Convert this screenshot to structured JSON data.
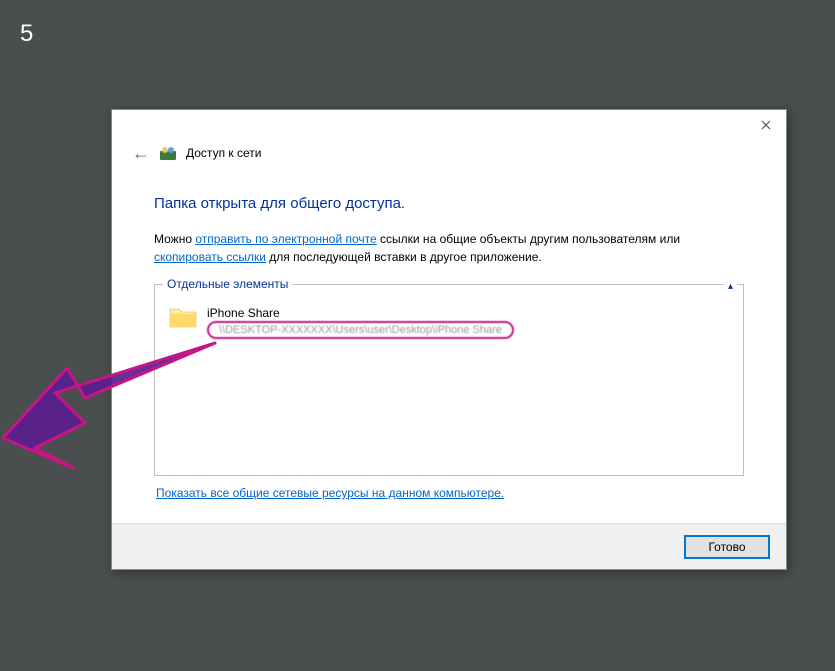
{
  "step_number": "5",
  "header": {
    "title": "Доступ к сети"
  },
  "main": {
    "heading": "Папка открыта для общего доступа.",
    "desc_part1": "Можно ",
    "link_email": "отправить по электронной почте",
    "desc_part2": " ссылки на общие объекты другим пользователям или ",
    "link_copy": "скопировать ссылки",
    "desc_part3": " для последующей вставки в другое приложение."
  },
  "group": {
    "legend": "Отдельные элементы",
    "item": {
      "name": "iPhone Share",
      "path": "\\\\DESKTOP-XXXXXXX\\Users\\user\\Desktop\\iPhone Share"
    }
  },
  "footer": {
    "link": "Показать все общие сетевые ресурсы на данном компьютере."
  },
  "buttons": {
    "done": "Готово"
  }
}
